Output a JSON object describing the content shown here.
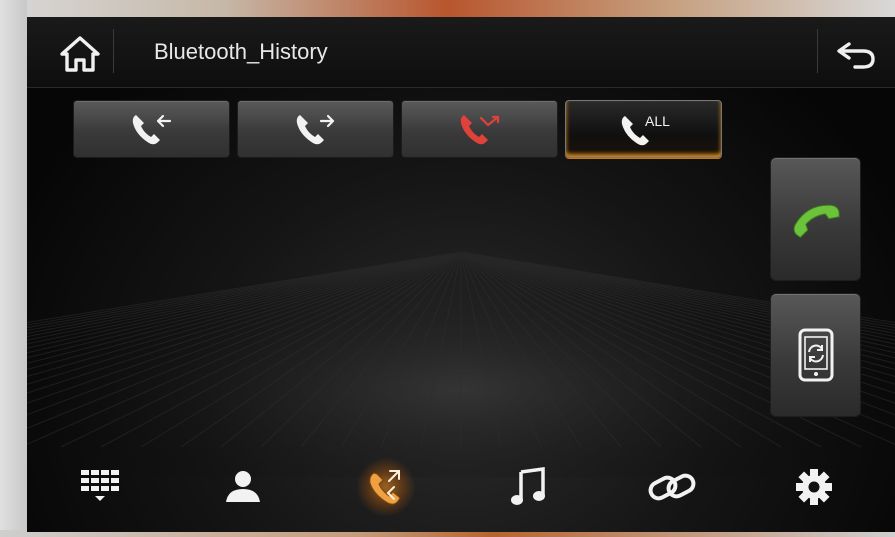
{
  "header": {
    "title": "Bluetooth_History",
    "home_icon": "home-icon",
    "back_icon": "back-arrow-icon"
  },
  "tabs": [
    {
      "icon": "incoming-call-icon",
      "label": ""
    },
    {
      "icon": "outgoing-call-icon",
      "label": ""
    },
    {
      "icon": "missed-call-icon",
      "label": ""
    },
    {
      "icon": "all-calls-icon",
      "label": "ALL",
      "selected": true
    }
  ],
  "side_buttons": [
    {
      "icon": "call-phone-icon"
    },
    {
      "icon": "phone-sync-icon"
    }
  ],
  "bottom_nav": [
    {
      "icon": "dialpad-icon"
    },
    {
      "icon": "contacts-icon"
    },
    {
      "icon": "call-history-icon",
      "selected": true
    },
    {
      "icon": "music-note-icon"
    },
    {
      "icon": "link-icon"
    },
    {
      "icon": "settings-gear-icon"
    }
  ],
  "colors": {
    "accent": "#e8912a",
    "missed": "#e0413a",
    "call_green": "#6cc23a",
    "text": "#e8e8e8"
  }
}
